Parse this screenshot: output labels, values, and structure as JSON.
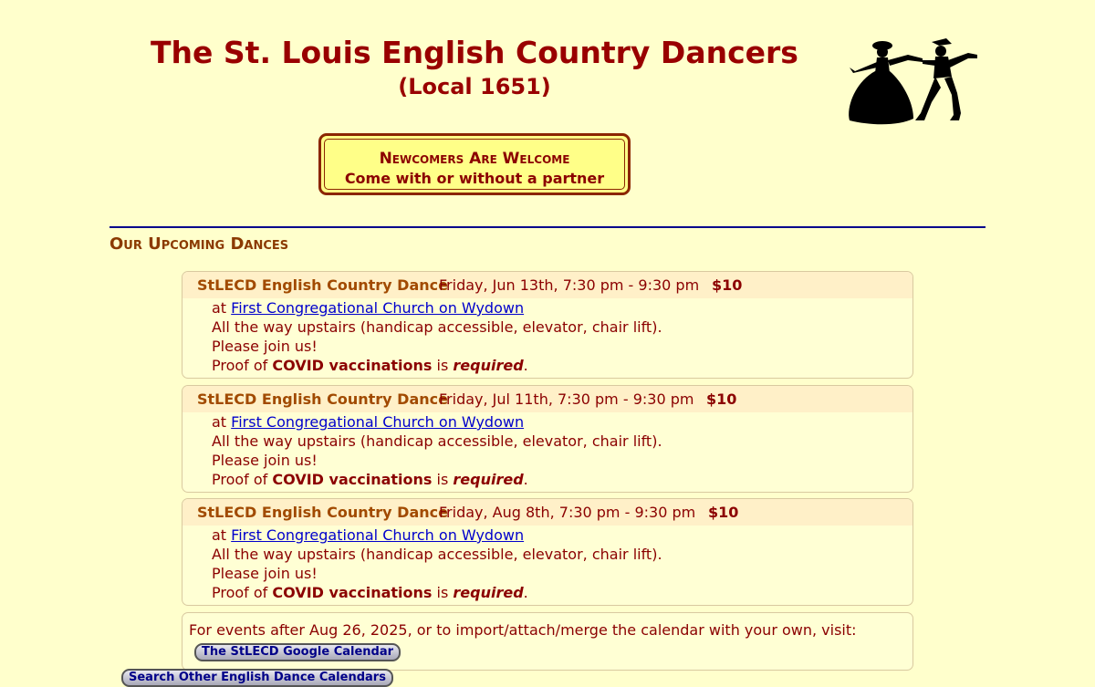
{
  "header": {
    "title": "The St. Louis English Country Dancers",
    "subtitle": "(Local 1651)"
  },
  "welcome": {
    "line1": "Newcomers Are Welcome",
    "line2": "Come with or without a partner"
  },
  "section": {
    "heading": "Our Upcoming Dances"
  },
  "events": [
    {
      "title": "StLECD English Country Dance",
      "when": "Friday, Jun 13th, 7:30 pm - 9:30 pm",
      "price": "$10",
      "at": "at",
      "venue": "First Congregational Church on Wydown",
      "note1": "All the way upstairs (handicap accessible, elevator, chair lift).",
      "note2": "Please join us!",
      "proof_pre": "Proof of",
      "proof_bold": "COVID vaccinations",
      "proof_mid": "is",
      "proof_req": "required",
      "proof_end": "."
    },
    {
      "title": "StLECD English Country Dance",
      "when": "Friday, Jul 11th, 7:30 pm - 9:30 pm",
      "price": "$10",
      "at": "at",
      "venue": "First Congregational Church on Wydown",
      "note1": "All the way upstairs (handicap accessible, elevator, chair lift).",
      "note2": "Please join us!",
      "proof_pre": "Proof of",
      "proof_bold": "COVID vaccinations",
      "proof_mid": "is",
      "proof_req": "required",
      "proof_end": "."
    },
    {
      "title": "StLECD English Country Dance",
      "when": "Friday, Aug 8th, 7:30 pm - 9:30 pm",
      "price": "$10",
      "at": "at",
      "venue": "First Congregational Church on Wydown",
      "note1": "All the way upstairs (handicap accessible, elevator, chair lift).",
      "note2": "Please join us!",
      "proof_pre": "Proof of",
      "proof_bold": "COVID vaccinations",
      "proof_mid": "is",
      "proof_req": "required",
      "proof_end": "."
    }
  ],
  "calendar": {
    "text": "For events after Aug 26, 2025, or to import/attach/merge the calendar with your own, visit:",
    "button": "The StLECD Google Calendar"
  },
  "other_button": "Search Other English Dance Calendars",
  "colors": {
    "background": "#ffffcc",
    "title": "#990000",
    "link": "#0000cc",
    "divider": "#00008b"
  }
}
